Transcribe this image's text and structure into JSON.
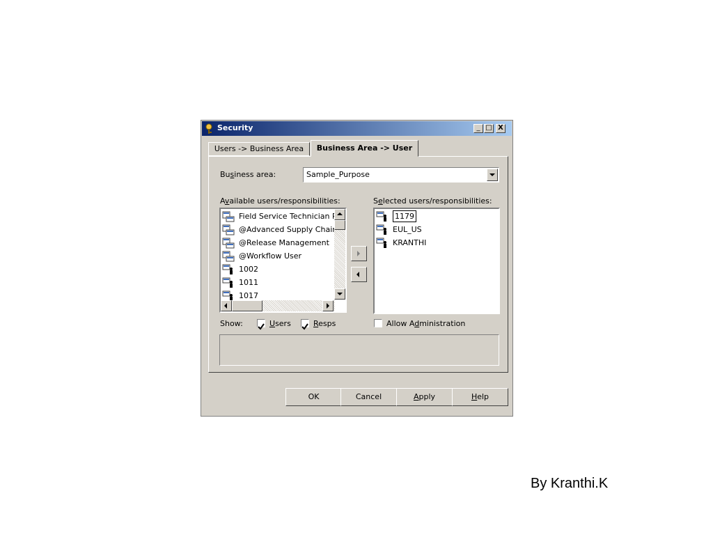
{
  "window": {
    "title": "Security",
    "minimize": "_",
    "maximize": "□",
    "close": "X"
  },
  "tabs": [
    {
      "label": "Users -> Business Area"
    },
    {
      "label": "Business Area -> User"
    }
  ],
  "business_area": {
    "label_pre": "Bu",
    "label_u": "s",
    "label_post": "iness area:",
    "value": "Sample_Purpose"
  },
  "available": {
    "label_pre": "A",
    "label_u": "v",
    "label_post": "ailable users/responsibilities:",
    "items": [
      {
        "label": "Field Service Technician Po",
        "icon": "responsibility-icon"
      },
      {
        "label": "@Advanced Supply Chain P",
        "icon": "responsibility-icon"
      },
      {
        "label": "@Release Management",
        "icon": "responsibility-icon"
      },
      {
        "label": "@Workflow User",
        "icon": "responsibility-icon"
      },
      {
        "label": "1002",
        "icon": "user-icon"
      },
      {
        "label": "1011",
        "icon": "user-icon"
      },
      {
        "label": "1017",
        "icon": "user-icon"
      }
    ]
  },
  "selected": {
    "label_pre": "S",
    "label_u": "e",
    "label_post": "lected users/responsibilities:",
    "items": [
      {
        "label": "1179",
        "icon": "user-icon"
      },
      {
        "label": "EUL_US",
        "icon": "user-icon"
      },
      {
        "label": "KRANTHI",
        "icon": "user-icon"
      }
    ]
  },
  "show": {
    "label": "Show:",
    "users_u": "U",
    "users_rest": "sers",
    "resps_u": "R",
    "resps_rest": "esps"
  },
  "allow_admin": {
    "pre": "Allow A",
    "u": "d",
    "post": "ministration"
  },
  "buttons": {
    "ok": "OK",
    "cancel": "Cancel",
    "apply_u": "A",
    "apply_rest": "pply",
    "help_u": "H",
    "help_rest": "elp"
  },
  "caption": "By Kranthi.K"
}
